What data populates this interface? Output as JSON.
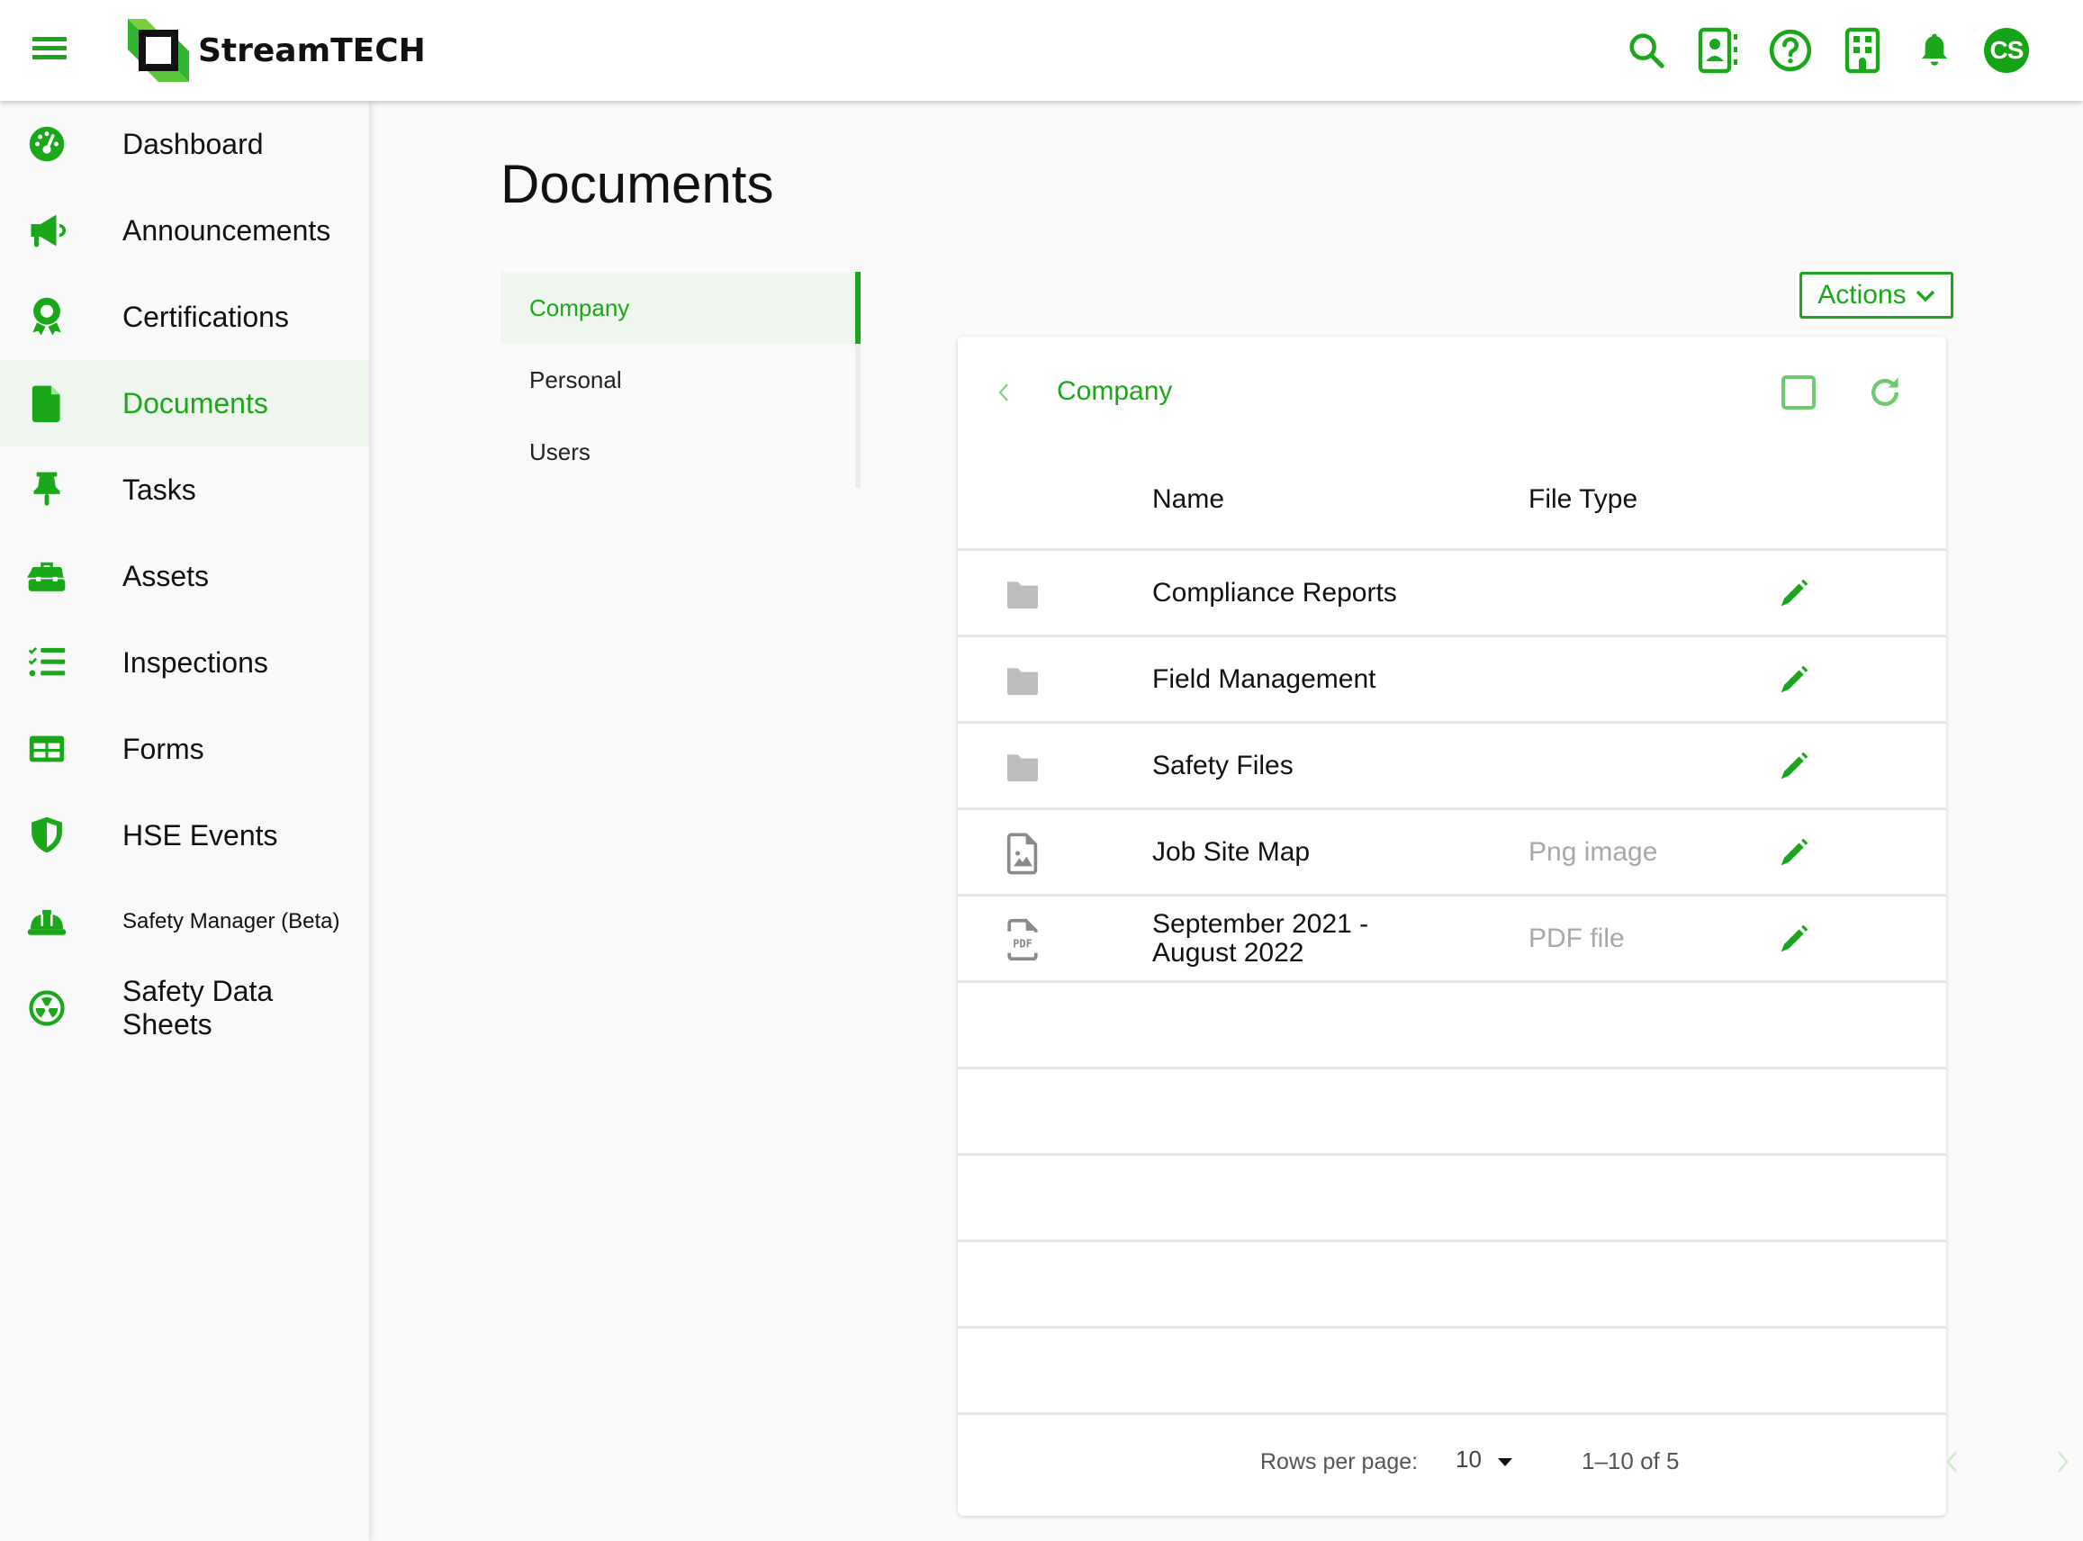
{
  "header": {
    "brand": "StreamTECH",
    "avatar_initials": "CS",
    "icons": [
      "search-icon",
      "contacts-icon",
      "help-icon",
      "building-icon",
      "bell-icon"
    ]
  },
  "colors": {
    "accent": "#1aa81a",
    "active_bg": "#eef6ee",
    "muted_text": "#a8a8a8",
    "folder_icon": "#bdbdbd"
  },
  "sidebar": {
    "items": [
      {
        "label": "Dashboard",
        "icon": "dashboard-gauge-icon"
      },
      {
        "label": "Announcements",
        "icon": "megaphone-icon"
      },
      {
        "label": "Certifications",
        "icon": "award-ribbon-icon"
      },
      {
        "label": "Documents",
        "icon": "document-icon",
        "active": true
      },
      {
        "label": "Tasks",
        "icon": "pushpin-icon"
      },
      {
        "label": "Assets",
        "icon": "toolbox-icon"
      },
      {
        "label": "Inspections",
        "icon": "checklist-icon"
      },
      {
        "label": "Forms",
        "icon": "table-form-icon"
      },
      {
        "label": "HSE Events",
        "icon": "shield-icon"
      },
      {
        "label": "Safety Manager (Beta)",
        "icon": "hard-hat-icon"
      },
      {
        "label": "Safety Data Sheets",
        "icon": "radiation-icon"
      }
    ]
  },
  "main": {
    "title": "Documents",
    "tabs": [
      {
        "label": "Company",
        "active": true
      },
      {
        "label": "Personal"
      },
      {
        "label": "Users"
      }
    ],
    "actions_label": "Actions",
    "card": {
      "breadcrumb": "Company",
      "columns": {
        "name": "Name",
        "file_type": "File Type"
      },
      "rows": [
        {
          "name": "Compliance Reports",
          "file_type": "",
          "icon": "folder-icon"
        },
        {
          "name": "Field Management",
          "file_type": "",
          "icon": "folder-icon"
        },
        {
          "name": "Safety Files",
          "file_type": "",
          "icon": "folder-icon"
        },
        {
          "name": "Job Site Map",
          "file_type": "Png image",
          "icon": "image-file-icon"
        },
        {
          "name": "September 2021 - August 2022",
          "file_type": "PDF file",
          "icon": "pdf-file-icon"
        }
      ],
      "empty_rows": 5,
      "footer": {
        "rows_per_page_label": "Rows per page:",
        "rows_per_page_value": "10",
        "range_label": "1–10 of 5"
      }
    }
  }
}
